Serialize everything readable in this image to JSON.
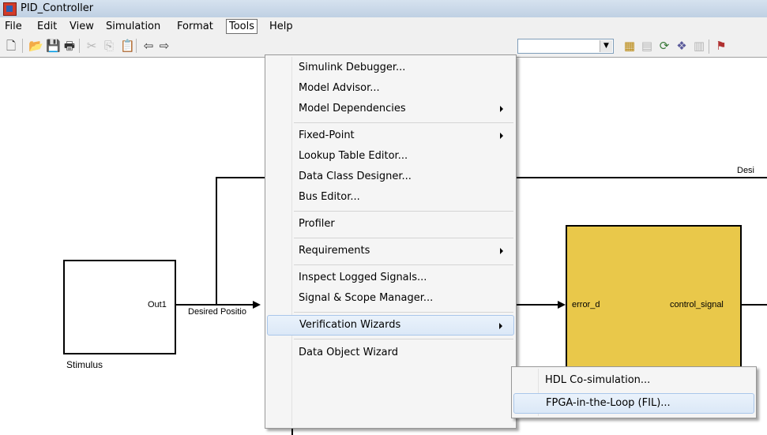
{
  "window": {
    "title": "PID_Controller"
  },
  "menubar": [
    "File",
    "Edit",
    "View",
    "Simulation",
    "Format",
    "Tools",
    "Help"
  ],
  "tools_menu": {
    "items": [
      {
        "label": "Simulink Debugger...",
        "submenu": false
      },
      {
        "label": "Model Advisor...",
        "submenu": false
      },
      {
        "label": "Model Dependencies",
        "submenu": true
      },
      {
        "label": "Fixed-Point",
        "submenu": true
      },
      {
        "label": "Lookup Table Editor...",
        "submenu": false
      },
      {
        "label": "Data Class Designer...",
        "submenu": false
      },
      {
        "label": "Bus Editor...",
        "submenu": false
      },
      {
        "label": "Profiler",
        "submenu": false
      },
      {
        "label": "Requirements",
        "submenu": true
      },
      {
        "label": "Inspect Logged Signals...",
        "submenu": false
      },
      {
        "label": "Signal & Scope Manager...",
        "submenu": false
      },
      {
        "label": "Verification Wizards",
        "submenu": true
      },
      {
        "label": "Data Object Wizard",
        "submenu": false
      }
    ]
  },
  "verification_submenu": {
    "items": [
      {
        "label": "HDL Co-simulation..."
      },
      {
        "label": "FPGA-in-the-Loop (FIL)..."
      }
    ]
  },
  "diagram": {
    "stimulus_label": "Stimulus",
    "out_port": "Out1",
    "signal_label": "Desired Positio",
    "desi_label": "Desi",
    "in_port": "error_d",
    "out_port_right": "control_signal"
  },
  "colors": {
    "block_fill": "#e9c84a",
    "menu_bg": "#f5f5f5",
    "highlight": "#dbe8f7"
  }
}
